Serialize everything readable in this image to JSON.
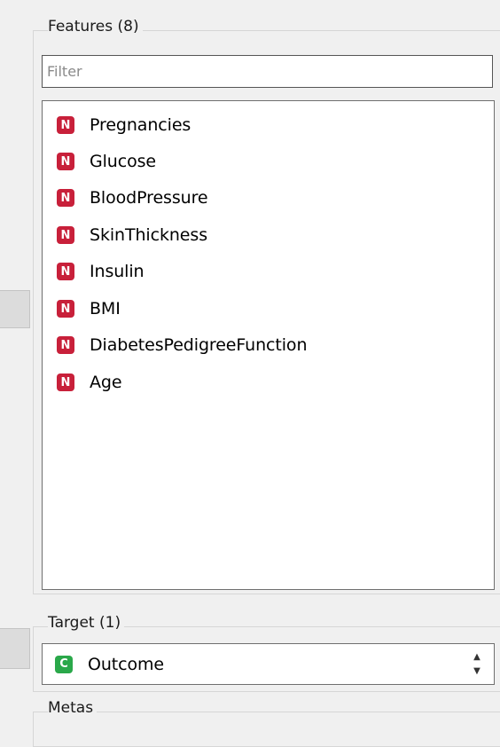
{
  "features": {
    "title": "Features (8)",
    "filter_placeholder": "Filter",
    "items": [
      {
        "badge": "N",
        "label": "Pregnancies"
      },
      {
        "badge": "N",
        "label": "Glucose"
      },
      {
        "badge": "N",
        "label": "BloodPressure"
      },
      {
        "badge": "N",
        "label": "SkinThickness"
      },
      {
        "badge": "N",
        "label": "Insulin"
      },
      {
        "badge": "N",
        "label": "BMI"
      },
      {
        "badge": "N",
        "label": "DiabetesPedigreeFunction"
      },
      {
        "badge": "N",
        "label": "Age"
      }
    ]
  },
  "target": {
    "title": "Target (1)",
    "badge": "C",
    "value": "Outcome"
  },
  "metas": {
    "title": "Metas"
  },
  "colors": {
    "numeric_badge": "#c8203a",
    "categorical_badge": "#2aa84a"
  }
}
